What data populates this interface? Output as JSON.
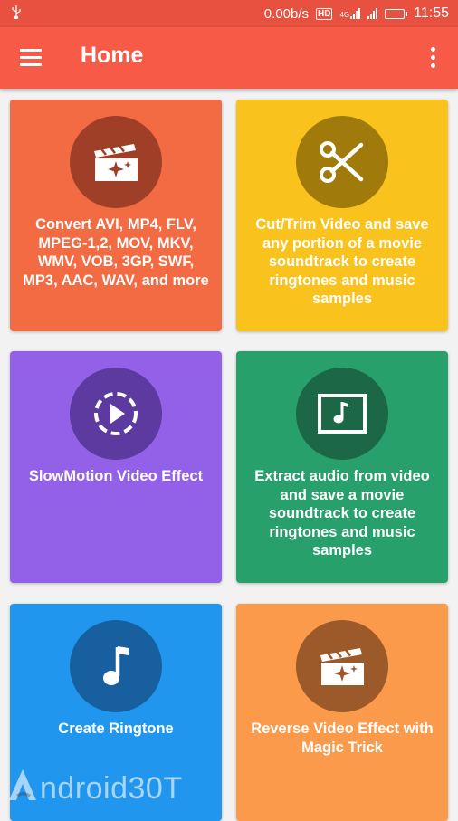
{
  "status_bar": {
    "speed": "0.00b/s",
    "network": "4G",
    "time": "11:55"
  },
  "app_bar": {
    "title": "Home"
  },
  "cards": [
    {
      "text": "Convert AVI, MP4, FLV, MPEG-1,2, MOV, MKV, WMV, VOB, 3GP, SWF, MP3, AAC, WAV, and more",
      "icon": "movie-magic-icon",
      "color": "#f26b43"
    },
    {
      "text": "Cut/Trim Video and save any portion of a movie soundtrack to create ringtones and music samples",
      "icon": "scissors-icon",
      "color": "#f9c21d"
    },
    {
      "text": "SlowMotion Video Effect",
      "icon": "slow-motion-icon",
      "color": "#9360e8"
    },
    {
      "text": "Extract audio from video and save a movie soundtrack to create ringtones and music samples",
      "icon": "music-video-icon",
      "color": "#27a06c"
    },
    {
      "text": "Create Ringtone",
      "icon": "music-note-icon",
      "color": "#2196ef"
    },
    {
      "text": "Reverse Video Effect with Magic Trick",
      "icon": "movie-magic-icon",
      "color": "#fb9a4b"
    }
  ],
  "watermark": "ndroid30T"
}
